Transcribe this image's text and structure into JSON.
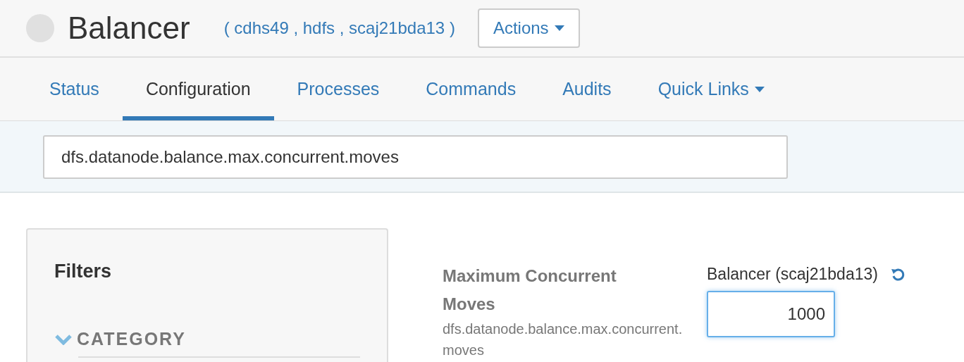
{
  "header": {
    "title": "Balancer",
    "context": "( cdhs49 , hdfs , scaj21bda13 )",
    "actions": "Actions"
  },
  "tabs": [
    {
      "label": "Status",
      "selected": false,
      "dropdown": false
    },
    {
      "label": "Configuration",
      "selected": true,
      "dropdown": false
    },
    {
      "label": "Processes",
      "selected": false,
      "dropdown": false
    },
    {
      "label": "Commands",
      "selected": false,
      "dropdown": false
    },
    {
      "label": "Audits",
      "selected": false,
      "dropdown": false
    },
    {
      "label": "Quick Links",
      "selected": false,
      "dropdown": true
    }
  ],
  "search": {
    "value": "dfs.datanode.balance.max.concurrent.moves"
  },
  "filters": {
    "title": "Filters",
    "category": {
      "label": "CATEGORY",
      "expanded": true
    }
  },
  "setting": {
    "label": "Maximum Concurrent Moves",
    "key": "dfs.datanode.balance.max.concurrent.moves",
    "scope": "Balancer (scaj21bda13)",
    "value": "1000"
  }
}
